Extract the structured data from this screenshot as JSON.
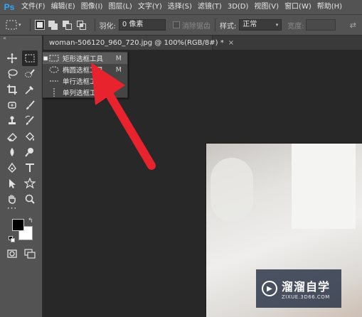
{
  "app": {
    "logo": "Ps"
  },
  "menu": [
    "文件(F)",
    "编辑(E)",
    "图像(I)",
    "图层(L)",
    "文字(Y)",
    "选择(S)",
    "滤镜(T)",
    "3D(D)",
    "视图(V)",
    "窗口(W)",
    "帮助(H)"
  ],
  "options": {
    "feather_label": "羽化:",
    "feather_value": "0 像素",
    "antialias_label": "消除锯齿",
    "style_label": "样式:",
    "style_value": "正常",
    "width_label": "宽度:"
  },
  "tab": {
    "title": "woman-506120_960_720.jpg @ 100%(RGB/8#) *",
    "close": "×"
  },
  "flyout": {
    "items": [
      {
        "label": "矩形选框工具",
        "shortcut": "M",
        "active": true,
        "icon": "rect-marquee-icon"
      },
      {
        "label": "椭圆选框工具",
        "shortcut": "M",
        "active": false,
        "icon": "ellipse-marquee-icon"
      },
      {
        "label": "单行选框工具",
        "shortcut": "",
        "active": false,
        "icon": "single-row-marquee-icon"
      },
      {
        "label": "单列选框工具",
        "shortcut": "",
        "active": false,
        "icon": "single-column-marquee-icon"
      }
    ]
  },
  "watermark": {
    "title": "溜溜自学",
    "sub": "ZIXUE.3D66.COM"
  },
  "colors": {
    "accent": "#31a8ff",
    "arrow": "#e8232e",
    "panel": "#535353",
    "workspace": "#282828"
  }
}
